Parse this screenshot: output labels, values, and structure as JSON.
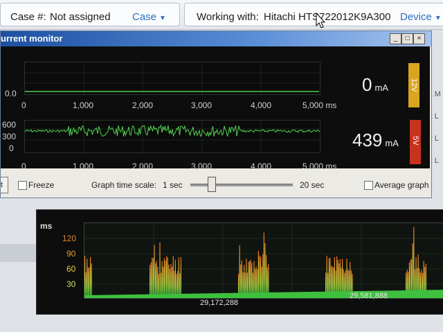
{
  "topbar": {
    "case_label": "Case #:",
    "case_value": "Not assigned",
    "case_menu": "Case",
    "working_label": "Working with:",
    "device_name": "Hitachi HTS722012K9A300",
    "device_menu": "Device"
  },
  "right_edge_fragments": [
    "dia M",
    "est L",
    "est L",
    "est L"
  ],
  "window": {
    "title": "urrent monitor",
    "buttons": [
      "_",
      "□",
      "×"
    ]
  },
  "monitor12v": {
    "ytick": "0.0",
    "xticks": [
      "0",
      "1,000",
      "2,000",
      "3,000",
      "4,000",
      "5,000 ms"
    ],
    "value": "0",
    "unit": "mA",
    "badge": "12V",
    "badge_color": "#d9a521",
    "samples_ma": [
      0,
      0,
      0,
      0,
      0,
      0,
      0,
      0,
      0,
      0,
      0,
      0,
      0,
      0,
      0,
      0,
      0,
      0,
      0,
      0,
      0,
      0,
      0,
      0
    ]
  },
  "monitor5v": {
    "yticks": [
      "600",
      "300",
      "0"
    ],
    "xticks": [
      "0",
      "1,000",
      "2,000",
      "3,000",
      "4,000",
      "5,000 ms"
    ],
    "value": "439",
    "unit": "mA",
    "badge": "5V",
    "badge_color": "#c8321f"
  },
  "controls": {
    "freeze_label": "Freeze",
    "scale_label": "Graph time scale:",
    "scale_value": "1 sec",
    "scale_max": "20 sec",
    "average_label": "Average graph",
    "slider_fraction": 0.2
  },
  "latency_chart": {
    "unit_label": "ms",
    "yticks": [
      "120",
      "90",
      "60",
      "30"
    ],
    "ytick_colors": [
      "#e08a2a",
      "#e0a030",
      "#e8d040",
      "#cfe060"
    ],
    "xlabels": [
      "29,172,288",
      "29,581,888"
    ],
    "accent": "#4ed04e"
  }
}
